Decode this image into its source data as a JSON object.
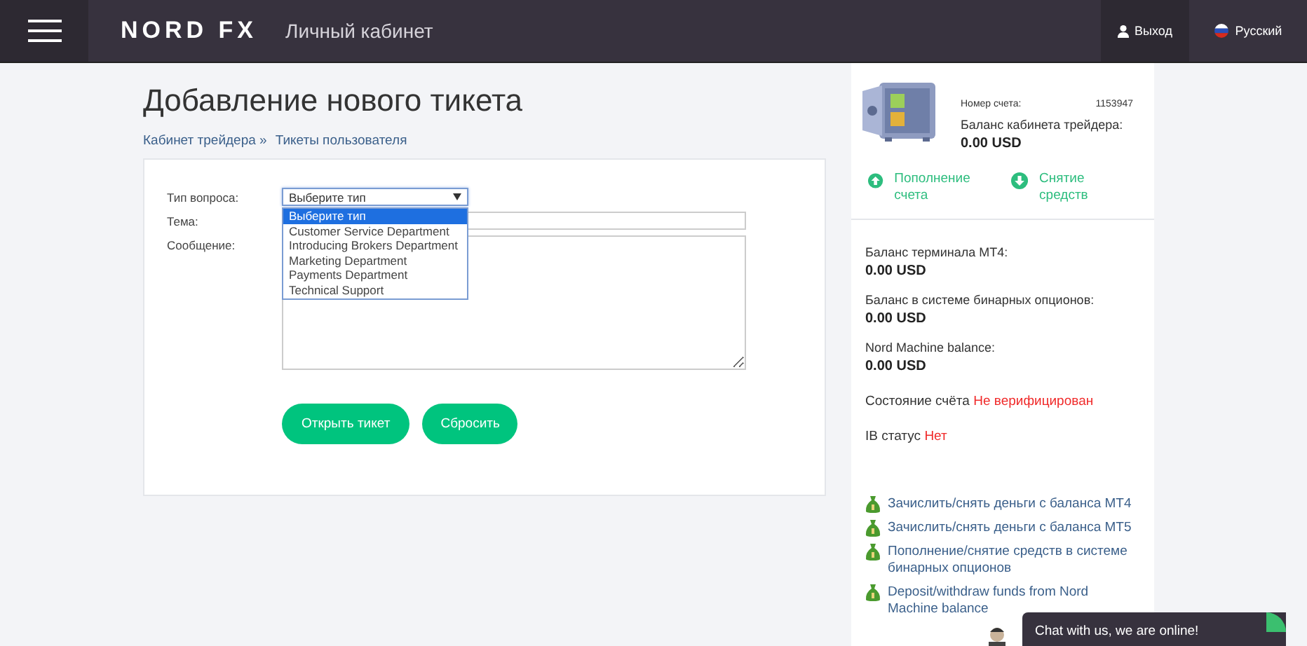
{
  "header": {
    "brand": "NORD FX",
    "subtitle": "Личный кабинет",
    "logout": "Выход",
    "language": "Русский"
  },
  "page": {
    "title": "Добавление нового тикета",
    "breadcrumbs": [
      "Кабинет трейдера »",
      "Тикеты пользователя"
    ]
  },
  "form": {
    "type_label": "Тип вопроса:",
    "type_select": {
      "value": "Выберите тип",
      "expanded": true,
      "options": [
        {
          "label": "Выберите тип",
          "selected": true
        },
        {
          "label": "Customer Service Department",
          "selected": false
        },
        {
          "label": "Introducing Brokers Department",
          "selected": false
        },
        {
          "label": "Marketing Department",
          "selected": false
        },
        {
          "label": "Payments Department",
          "selected": false
        },
        {
          "label": "Technical Support",
          "selected": false
        }
      ]
    },
    "subject_label": "Тема:",
    "message_label": "Сообщение:",
    "buttons": [
      "Открыть тикет",
      "Сбросить"
    ]
  },
  "sidebar": {
    "account_label": "Номер счета:",
    "account_number": "1153947",
    "cabinet_balance_label": "Баланс кабинета трейдера:",
    "cabinet_balance": "0.00 USD",
    "actions": [
      {
        "kind": "deposit",
        "label": "Пополнение счета"
      },
      {
        "kind": "withdraw",
        "label": "Снятие средств"
      }
    ],
    "balances": [
      {
        "label": "Баланс терминала МТ4:",
        "value": "0.00 USD"
      },
      {
        "label": "Баланс в системе бинарных опционов:",
        "value": "0.00 USD"
      },
      {
        "label": "Nord Machine balance:",
        "value": "0.00 USD"
      }
    ],
    "statuses": [
      {
        "label": "Состояние счёта",
        "value": "Не верифицирован"
      },
      {
        "label": "IB статус",
        "value": "Нет"
      }
    ],
    "links": [
      "Зачислить/снять деньги с баланса МТ4",
      "Зачислить/снять деньги с баланса МТ5",
      "Пополнение/снятие средств в системе бинарных опционов",
      "Deposit/withdraw funds from Nord Machine balance"
    ]
  },
  "chat": {
    "text": "Chat with us, we are online!"
  }
}
